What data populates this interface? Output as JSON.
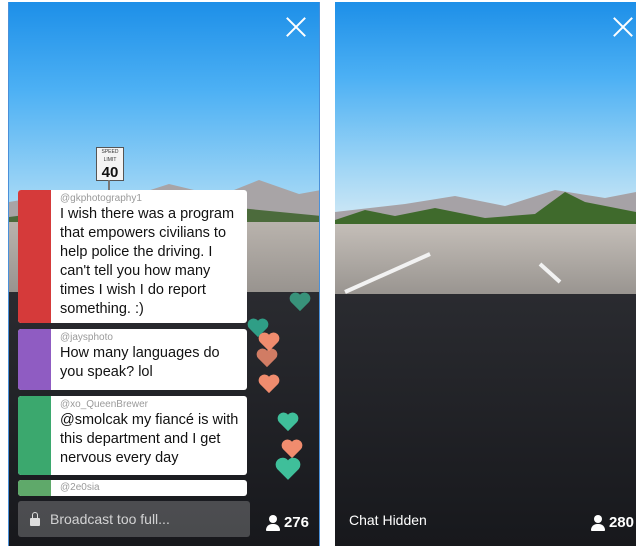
{
  "left": {
    "chats": [
      {
        "user": "@gkphotography1",
        "text": "I wish there was a program that empowers civilians to help police the driving.  I can't tell you how many times I wish I do report something.  :)"
      },
      {
        "user": "@jaysphoto",
        "text": "How many languages do you speak? lol"
      },
      {
        "user": "@xo_QueenBrewer",
        "text": "@smolcak my fiancé is with this department and I get nervous every day"
      },
      {
        "user": "@2e0sia",
        "text": ""
      }
    ],
    "input_placeholder": "Broadcast too full...",
    "viewer_count": "276",
    "sign_text": "40"
  },
  "right": {
    "chat_status": "Chat Hidden",
    "viewer_count": "280"
  },
  "colors": {
    "heart_teal": "#3fbf9a",
    "heart_coral": "#f08c6e",
    "border": "#4a90d9"
  },
  "icons": [
    "close-icon",
    "lock-icon",
    "person-icon",
    "heart-icon"
  ]
}
